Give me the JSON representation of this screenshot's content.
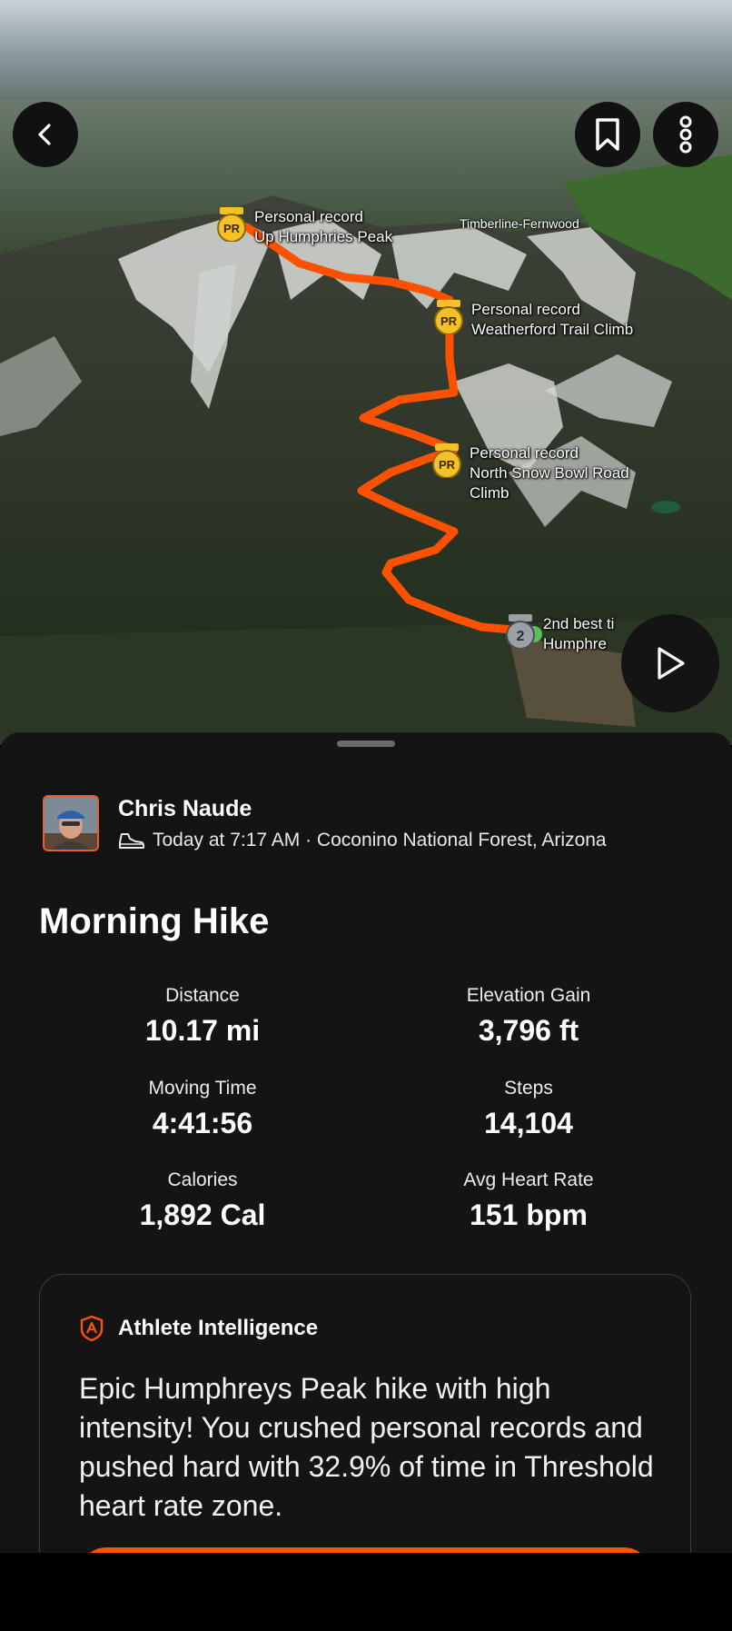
{
  "map": {
    "place_label": "Timberline-Fernwood",
    "segments": [
      {
        "badge": "PR",
        "line1": "Personal record",
        "line2": "Up Humphries Peak",
        "line3": ""
      },
      {
        "badge": "PR",
        "line1": "Personal record",
        "line2": "Weatherford Trail Climb",
        "line3": ""
      },
      {
        "badge": "PR",
        "line1": "Personal record",
        "line2": "North Snow Bowl Road",
        "line3": "Climb"
      },
      {
        "badge": "2",
        "line1": "2nd best ti",
        "line2": "Humphre",
        "line3": ""
      }
    ],
    "route_color": "#fc5200",
    "buttons": {
      "back": "chevron-left-icon",
      "bookmark": "bookmark-icon",
      "more": "more-vertical-icon",
      "play": "play-icon"
    }
  },
  "activity": {
    "athlete_name": "Chris Naude",
    "meta": "Today at 7:17 AM · Coconino National Forest, Arizona",
    "activity_icon": "hiking-shoe-icon",
    "title": "Morning Hike",
    "stats": [
      {
        "label": "Distance",
        "value": "10.17 mi"
      },
      {
        "label": "Elevation Gain",
        "value": "3,796 ft"
      },
      {
        "label": "Moving Time",
        "value": "4:41:56"
      },
      {
        "label": "Steps",
        "value": "14,104"
      },
      {
        "label": "Calories",
        "value": "1,892 Cal"
      },
      {
        "label": "Avg Heart Rate",
        "value": "151 bpm"
      }
    ]
  },
  "athlete_intelligence": {
    "title": "Athlete Intelligence",
    "summary": "Epic Humphreys Peak hike with high intensity! You crushed personal records and pushed hard with 32.9% of time in Threshold heart rate zone.",
    "accent_color": "#fc5200"
  }
}
